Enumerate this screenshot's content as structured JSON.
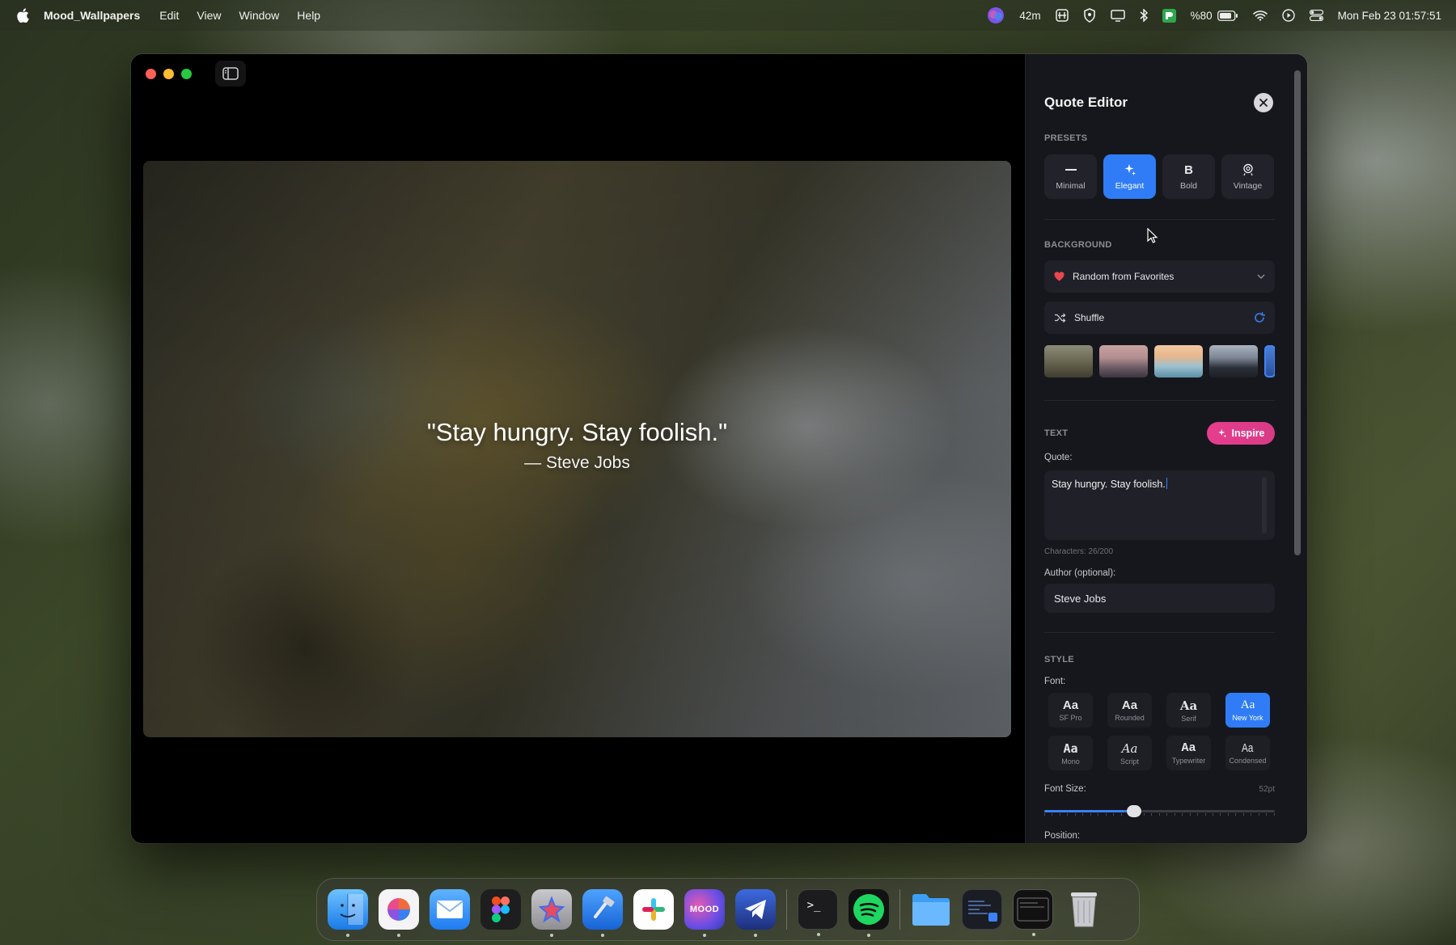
{
  "menubar": {
    "app_name": "Mood_Wallpapers",
    "items": [
      "Edit",
      "View",
      "Window",
      "Help"
    ],
    "status": {
      "timer": "42m",
      "battery_percent": "%80",
      "datetime": "Mon Feb 23  01:57:51"
    }
  },
  "preview": {
    "quote": "\"Stay hungry. Stay foolish.\"",
    "author": "— Steve Jobs"
  },
  "editor": {
    "title": "Quote Editor",
    "presets": {
      "label": "PRESETS",
      "items": [
        {
          "label": "Minimal",
          "icon": "minus-icon"
        },
        {
          "label": "Elegant",
          "icon": "sparkle-icon"
        },
        {
          "label": "Bold",
          "icon": "B"
        },
        {
          "label": "Vintage",
          "icon": "vintage-icon"
        }
      ],
      "selected": "Elegant"
    },
    "background": {
      "label": "BACKGROUND",
      "source": "Random from Favorites",
      "shuffle_label": "Shuffle"
    },
    "text": {
      "label": "TEXT",
      "inspire_label": "Inspire",
      "quote_label": "Quote:",
      "quote_value": "Stay hungry. Stay foolish.",
      "char_count": "Characters: 26/200",
      "author_label": "Author (optional):",
      "author_value": "Steve Jobs"
    },
    "style": {
      "label": "STYLE",
      "font_label": "Font:",
      "fonts": [
        {
          "glyph": "Aa",
          "name": "SF Pro"
        },
        {
          "glyph": "Aa",
          "name": "Rounded"
        },
        {
          "glyph": "Aa",
          "name": "Serif"
        },
        {
          "glyph": "Aa",
          "name": "New York"
        },
        {
          "glyph": "Aa",
          "name": "Mono"
        },
        {
          "glyph": "Aa",
          "name": "Script"
        },
        {
          "glyph": "Aa",
          "name": "Typewriter"
        },
        {
          "glyph": "Aa",
          "name": "Condensed"
        }
      ],
      "selected_font": "New York",
      "font_size_label": "Font Size:",
      "font_size_value": "52pt",
      "font_size_fraction": 0.39,
      "position_label": "Position:"
    }
  },
  "dock": {
    "apps": [
      "Finder",
      "Launchpad",
      "Mail",
      "Figma",
      "Pixelmator",
      "Xcode",
      "Slack",
      "MOOD",
      "Telegram",
      "Terminal",
      "Spotify",
      "Files",
      "Xcode Window",
      "Window",
      "Trash"
    ],
    "mood_badge": "MOOD"
  },
  "colors": {
    "accent": "#2f7cf6",
    "inspire": "#e73d8f",
    "panel": "#16171c"
  }
}
